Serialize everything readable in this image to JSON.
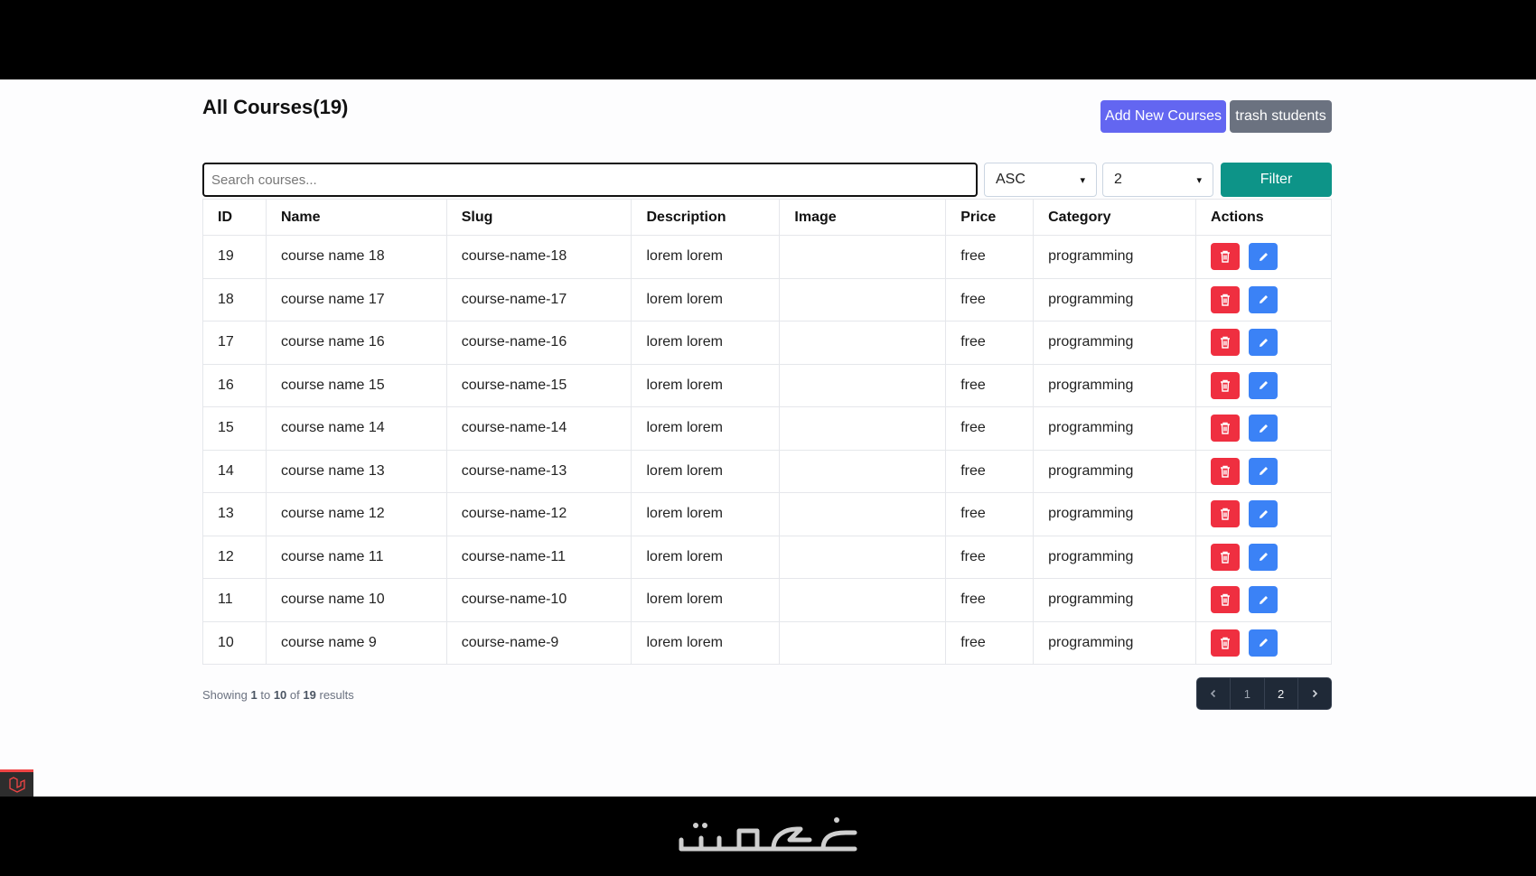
{
  "header": {
    "title": "All Courses(19)",
    "add_button": "Add New Courses",
    "trash_button": "trash students"
  },
  "filters": {
    "search_placeholder": "Search courses...",
    "search_value": "",
    "order_selected": "ASC",
    "page_size_selected": "2",
    "filter_button": "Filter"
  },
  "table": {
    "columns": [
      "ID",
      "Name",
      "Slug",
      "Description",
      "Image",
      "Price",
      "Category",
      "Actions"
    ],
    "rows": [
      {
        "id": "19",
        "name": "course name 18",
        "slug": "course-name-18",
        "description": "lorem lorem",
        "image": "",
        "price": "free",
        "category": "programming"
      },
      {
        "id": "18",
        "name": "course name 17",
        "slug": "course-name-17",
        "description": "lorem lorem",
        "image": "",
        "price": "free",
        "category": "programming"
      },
      {
        "id": "17",
        "name": "course name 16",
        "slug": "course-name-16",
        "description": "lorem lorem",
        "image": "",
        "price": "free",
        "category": "programming"
      },
      {
        "id": "16",
        "name": "course name 15",
        "slug": "course-name-15",
        "description": "lorem lorem",
        "image": "",
        "price": "free",
        "category": "programming"
      },
      {
        "id": "15",
        "name": "course name 14",
        "slug": "course-name-14",
        "description": "lorem lorem",
        "image": "",
        "price": "free",
        "category": "programming"
      },
      {
        "id": "14",
        "name": "course name 13",
        "slug": "course-name-13",
        "description": "lorem lorem",
        "image": "",
        "price": "free",
        "category": "programming"
      },
      {
        "id": "13",
        "name": "course name 12",
        "slug": "course-name-12",
        "description": "lorem lorem",
        "image": "",
        "price": "free",
        "category": "programming"
      },
      {
        "id": "12",
        "name": "course name 11",
        "slug": "course-name-11",
        "description": "lorem lorem",
        "image": "",
        "price": "free",
        "category": "programming"
      },
      {
        "id": "11",
        "name": "course name 10",
        "slug": "course-name-10",
        "description": "lorem lorem",
        "image": "",
        "price": "free",
        "category": "programming"
      },
      {
        "id": "10",
        "name": "course name 9",
        "slug": "course-name-9",
        "description": "lorem lorem",
        "image": "",
        "price": "free",
        "category": "programming"
      }
    ],
    "row_actions": {
      "delete_icon": "trash-icon",
      "edit_icon": "pencil-icon"
    }
  },
  "pagination": {
    "showing_prefix": "Showing",
    "from": "1",
    "to_word": "to",
    "to": "10",
    "of_word": "of",
    "total": "19",
    "suffix": "results",
    "prev_icon": "chevron-left-icon",
    "pages": [
      "1",
      "2"
    ],
    "current_page": "2",
    "next_icon": "chevron-right-icon"
  },
  "colors": {
    "primary": "#6366f1",
    "secondary": "#6b7280",
    "filter": "#0d9488",
    "delete": "#ef2f40",
    "edit": "#3b82f6",
    "pager_bg": "#1f2937"
  },
  "debug_badge_icon": "laravel-icon",
  "watermark": {
    "text": "خمسات"
  }
}
